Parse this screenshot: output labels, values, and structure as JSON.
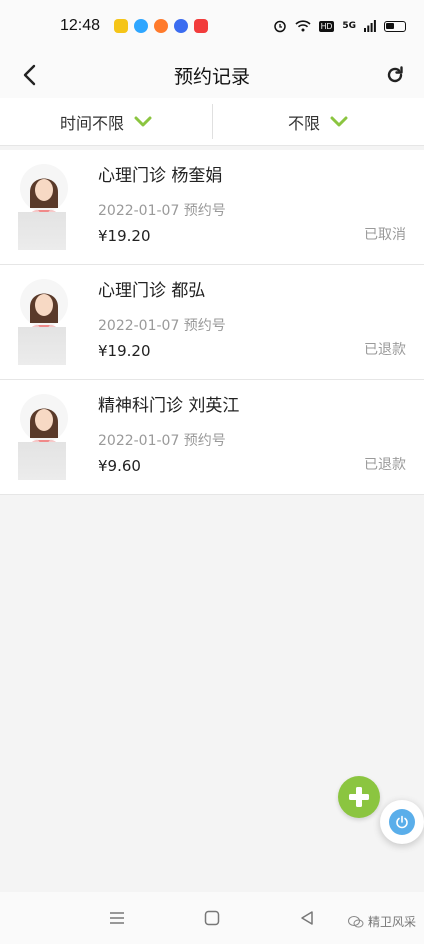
{
  "status_bar": {
    "time": "12:48",
    "hd": "HD",
    "network": "5G"
  },
  "header": {
    "title": "预约记录"
  },
  "filters": [
    {
      "label": "时间不限"
    },
    {
      "label": "不限"
    }
  ],
  "records": [
    {
      "title": "心理门诊 杨奎娟",
      "date": "2022-01-07 预约号",
      "price": "¥19.20",
      "status": "已取消"
    },
    {
      "title": "心理门诊 都弘",
      "date": "2022-01-07 预约号",
      "price": "¥19.20",
      "status": "已退款"
    },
    {
      "title": "精神科门诊 刘英江",
      "date": "2022-01-07 预约号",
      "price": "¥9.60",
      "status": "已退款"
    }
  ],
  "watermark": "精卫风采",
  "colors": {
    "accent_green": "#8bc540",
    "power_blue": "#5aaeea",
    "muted_text": "#9a9a9a"
  }
}
